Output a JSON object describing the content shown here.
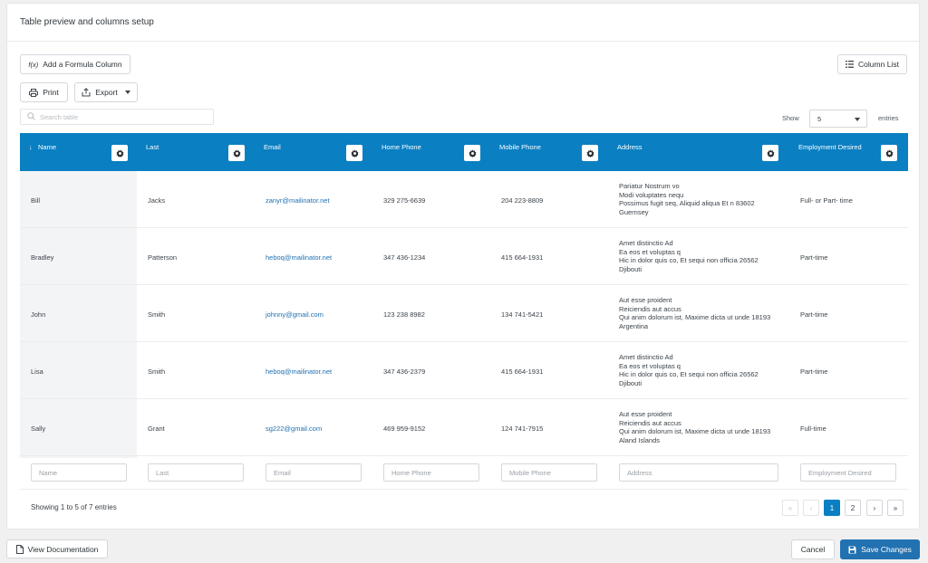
{
  "panel": {
    "title": "Table preview and columns setup"
  },
  "toolbar": {
    "formula_icon": "f(x)",
    "formula_label": "Add a Formula Column",
    "column_list_label": "Column List",
    "print_label": "Print",
    "export_label": "Export"
  },
  "search": {
    "placeholder": "Search table"
  },
  "show": {
    "label": "Show",
    "value": "5",
    "suffix": "entries"
  },
  "columns": [
    "Name",
    "Last",
    "Email",
    "Home Phone",
    "Mobile Phone",
    "Address",
    "Employment Desired"
  ],
  "sort_indicator": "↓",
  "rows": [
    {
      "name": "Bill",
      "last": "Jacks",
      "email": "zanyr@mailinator.net",
      "home": "329 275-6639",
      "mobile": "204 223-8809",
      "address": [
        "Pariatur Nostrum vo",
        "Modi voluptates nequ",
        "Possimus fugit seq, Aliquid aliqua Et n 83602",
        "Guernsey"
      ],
      "employment": "Full- or Part- time"
    },
    {
      "name": "Bradley",
      "last": "Patterson",
      "email": "heboq@mailinator.net",
      "home": "347 436-1234",
      "mobile": "415 664-1931",
      "address": [
        "Amet distinctio Ad",
        "Ea eos et voluptas q",
        "Hic in dolor quis co, Et sequi non officia 26562",
        "Djibouti"
      ],
      "employment": "Part-time"
    },
    {
      "name": "John",
      "last": "Smith",
      "email": "johnny@gmail.com",
      "home": "123 238 8982",
      "mobile": "134 741-5421",
      "address": [
        "Aut esse proident",
        "Reiciendis aut accus",
        "Qui anim dolorum ist, Maxime dicta ut unde 18193",
        "Argentina"
      ],
      "employment": "Part-time"
    },
    {
      "name": "Lisa",
      "last": "Smith",
      "email": "heboq@mailinator.net",
      "home": "347 436-2379",
      "mobile": "415 664-1931",
      "address": [
        "Amet distinctio Ad",
        "Ea eos et voluptas q",
        "Hic in dolor quis co, Et sequi non officia 26562",
        "Djibouti"
      ],
      "employment": "Part-time"
    },
    {
      "name": "Sally",
      "last": "Grant",
      "email": "sg222@gmail.com",
      "home": "469 959-9152",
      "mobile": "124 741-7915",
      "address": [
        "Aut esse proident",
        "Reiciendis aut accus",
        "Qui anim dolorum ist, Maxime dicta ut unde 18193",
        "Aland Islands"
      ],
      "employment": "Full-time"
    }
  ],
  "filters": [
    "Name",
    "Last",
    "Email",
    "Home Phone",
    "Mobile Phone",
    "Address",
    "Employment Desired"
  ],
  "footer": {
    "showing": "Showing 1 to 5 of 7 entries"
  },
  "pagination": {
    "first": "«",
    "prev": "‹",
    "pages": [
      "1",
      "2"
    ],
    "next": "›",
    "last": "»",
    "active_page": "1"
  },
  "bottom": {
    "docs_label": "View Documentation",
    "cancel_label": "Cancel",
    "save_label": "Save Changes"
  },
  "colors": {
    "header_bg": "#0a7fc2",
    "primary": "#2271b1",
    "link": "#2271b1"
  }
}
